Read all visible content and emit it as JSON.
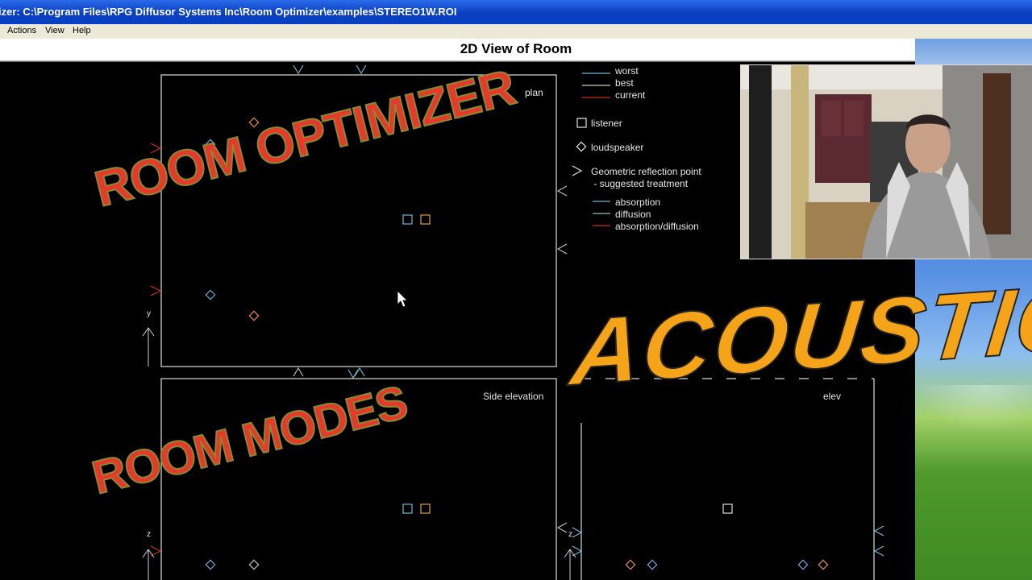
{
  "window": {
    "title": "izer: C:\\Program Files\\RPG Diffusor Systems Inc\\Room Optimizer\\examples\\STEREO1W.ROI"
  },
  "menu": {
    "items": [
      "Actions",
      "View",
      "Help"
    ]
  },
  "panel": {
    "title": "2D View of Room"
  },
  "views": {
    "plan_label": "plan",
    "side_label": "Side elevation",
    "front_label_partial": "elev",
    "plan_axis": "y",
    "side_axis": "z",
    "front_axis": "z"
  },
  "legend": {
    "worst": "worst",
    "best": "best",
    "current": "current",
    "listener": "listener",
    "loudspeaker": "loudspeaker",
    "reflection_line1": "Geometric reflection point",
    "reflection_line2": " - suggested treatment",
    "absorption": "absorption",
    "diffusion": "diffusion",
    "absorption_diffusion": "absorption/diffusion"
  },
  "colors": {
    "worst": "#6fb7d6",
    "best": "#c9d0a6",
    "current": "#c8301c",
    "absorption": "#6fb7d6",
    "diffusion": "#8fbcc4",
    "absorption_diffusion": "#c8301c",
    "speaker_orange": "#e08a50",
    "speaker_blue": "#6fa6d6",
    "overlay_red": "#e8372c",
    "overlay_orange": "#f5a319"
  },
  "overlays": {
    "room_optimizer": "ROOM OPTIMIZER",
    "room_modes": "ROOM MODES",
    "acoustics": "ACOUSTICS"
  },
  "webcam": {
    "alt": "presenter webcam"
  }
}
